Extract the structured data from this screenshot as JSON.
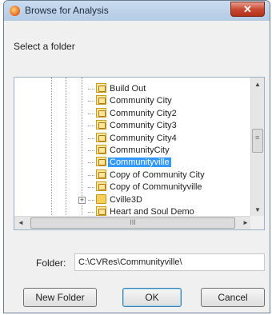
{
  "window": {
    "title": "Browse for Analysis",
    "close_glyph": "✕"
  },
  "instruction": "Select a folder",
  "tree": {
    "items": [
      {
        "label": "Build Out",
        "icon": "project-icon",
        "selected": false
      },
      {
        "label": "Community City",
        "icon": "project-icon",
        "selected": false
      },
      {
        "label": "Community City2",
        "icon": "project-icon",
        "selected": false
      },
      {
        "label": "Community City3",
        "icon": "project-icon",
        "selected": false
      },
      {
        "label": "Community City4",
        "icon": "project-icon",
        "selected": false
      },
      {
        "label": "CommunityCity",
        "icon": "project-icon",
        "selected": false
      },
      {
        "label": "Communityville",
        "icon": "project-icon",
        "selected": true
      },
      {
        "label": "Copy of Community City",
        "icon": "project-icon",
        "selected": false
      },
      {
        "label": "Copy of Communityville",
        "icon": "project-icon",
        "selected": false
      },
      {
        "label": "Cville3D",
        "icon": "folder-icon",
        "selected": false,
        "expander": "+"
      },
      {
        "label": "Heart and Soul Demo",
        "icon": "project-icon",
        "selected": false
      }
    ],
    "scroll_up": "▲",
    "scroll_down": "▼",
    "scroll_left": "◄",
    "scroll_right": "►",
    "hthumb_grip": "III"
  },
  "folder": {
    "label": "Folder:",
    "value": "C:\\CVRes\\Communityville\\"
  },
  "buttons": {
    "new_folder": "New Folder",
    "ok": "OK",
    "cancel": "Cancel"
  }
}
